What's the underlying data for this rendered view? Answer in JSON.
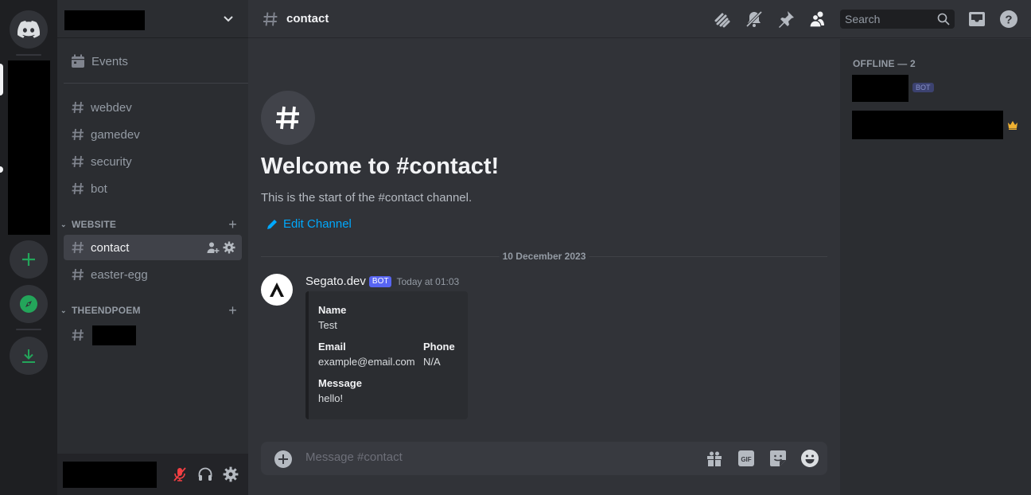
{
  "guilds": {
    "home_icon": "discord-logo-icon",
    "add_server_icon": "plus-icon",
    "explore_icon": "compass-icon",
    "download_icon": "download-icon"
  },
  "sidebar": {
    "server_name": "",
    "events_label": "Events",
    "channels": [
      {
        "name": "webdev"
      },
      {
        "name": "gamedev"
      },
      {
        "name": "security"
      },
      {
        "name": "bot"
      }
    ],
    "categories": [
      {
        "name": "WEBSITE",
        "channels": [
          {
            "name": "contact",
            "active": true
          },
          {
            "name": "easter-egg"
          }
        ]
      },
      {
        "name": "THEENDPOEM",
        "channels": [
          {
            "name": ""
          }
        ]
      }
    ]
  },
  "user_panel": {
    "mic_state": "muted",
    "colors": {
      "muted": "#f23f43"
    }
  },
  "topbar": {
    "channel_name": "contact",
    "search_placeholder": "Search",
    "icons": [
      "threads-icon",
      "notifications-muted-icon",
      "pin-icon",
      "member-list-icon",
      "inbox-icon",
      "help-icon"
    ]
  },
  "welcome": {
    "title": "Welcome to #contact!",
    "subtitle": "This is the start of the #contact channel.",
    "edit_label": "Edit Channel"
  },
  "date_divider": "10 December 2023",
  "message": {
    "author": "Segato.dev",
    "tag": "BOT",
    "timestamp": "Today at 01:03",
    "embed_fields": [
      {
        "name": "Name",
        "value": "Test"
      },
      {
        "name": "Email",
        "value": "example@email.com"
      },
      {
        "name": "Phone",
        "value": "N/A"
      },
      {
        "name": "Message",
        "value": "hello!"
      }
    ]
  },
  "composer": {
    "placeholder": "Message #contact"
  },
  "members": {
    "header": "OFFLINE — 2",
    "bot_tag": "BOT"
  },
  "colors": {
    "accent": "#5865f2",
    "link": "#00a8fc",
    "online_green": "#23a55a",
    "crown": "#f0b232"
  }
}
